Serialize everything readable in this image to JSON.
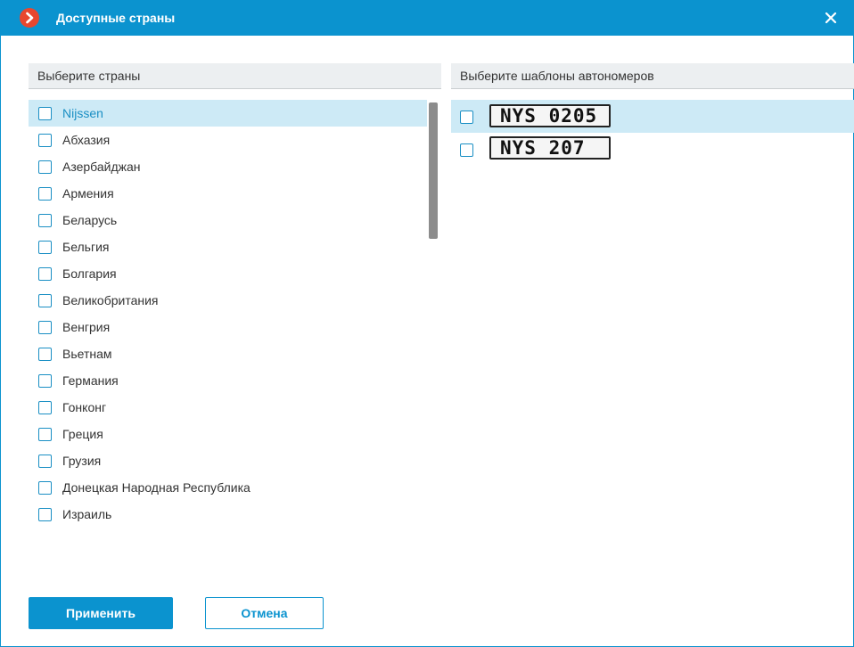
{
  "window": {
    "title": "Доступные страны",
    "app_icon": "chevron-right-icon",
    "close_icon": "close-icon"
  },
  "left_panel": {
    "header": "Выберите страны",
    "countries": [
      {
        "label": "Nijssen",
        "checked": false,
        "selected": true
      },
      {
        "label": "Абхазия",
        "checked": false
      },
      {
        "label": "Азербайджан",
        "checked": false
      },
      {
        "label": "Армения",
        "checked": false
      },
      {
        "label": "Беларусь",
        "checked": false
      },
      {
        "label": "Бельгия",
        "checked": false
      },
      {
        "label": "Болгария",
        "checked": false
      },
      {
        "label": "Великобритания",
        "checked": false
      },
      {
        "label": "Венгрия",
        "checked": false
      },
      {
        "label": "Вьетнам",
        "checked": false
      },
      {
        "label": "Германия",
        "checked": false
      },
      {
        "label": "Гонконг",
        "checked": false
      },
      {
        "label": "Греция",
        "checked": false
      },
      {
        "label": "Грузия",
        "checked": false
      },
      {
        "label": "Донецкая Народная Республика",
        "checked": false
      },
      {
        "label": "Израиль",
        "checked": false
      }
    ]
  },
  "right_panel": {
    "header": "Выберите шаблоны автономеров",
    "plates": [
      {
        "text": "NYS 0205",
        "checked": false,
        "selected": true
      },
      {
        "text": "NYS 207",
        "checked": false
      }
    ]
  },
  "buttons": {
    "apply": "Применить",
    "cancel": "Отмена"
  },
  "colors": {
    "accent": "#0b93cf",
    "selection": "#cdeaf6",
    "header_bg": "#eceff1"
  }
}
